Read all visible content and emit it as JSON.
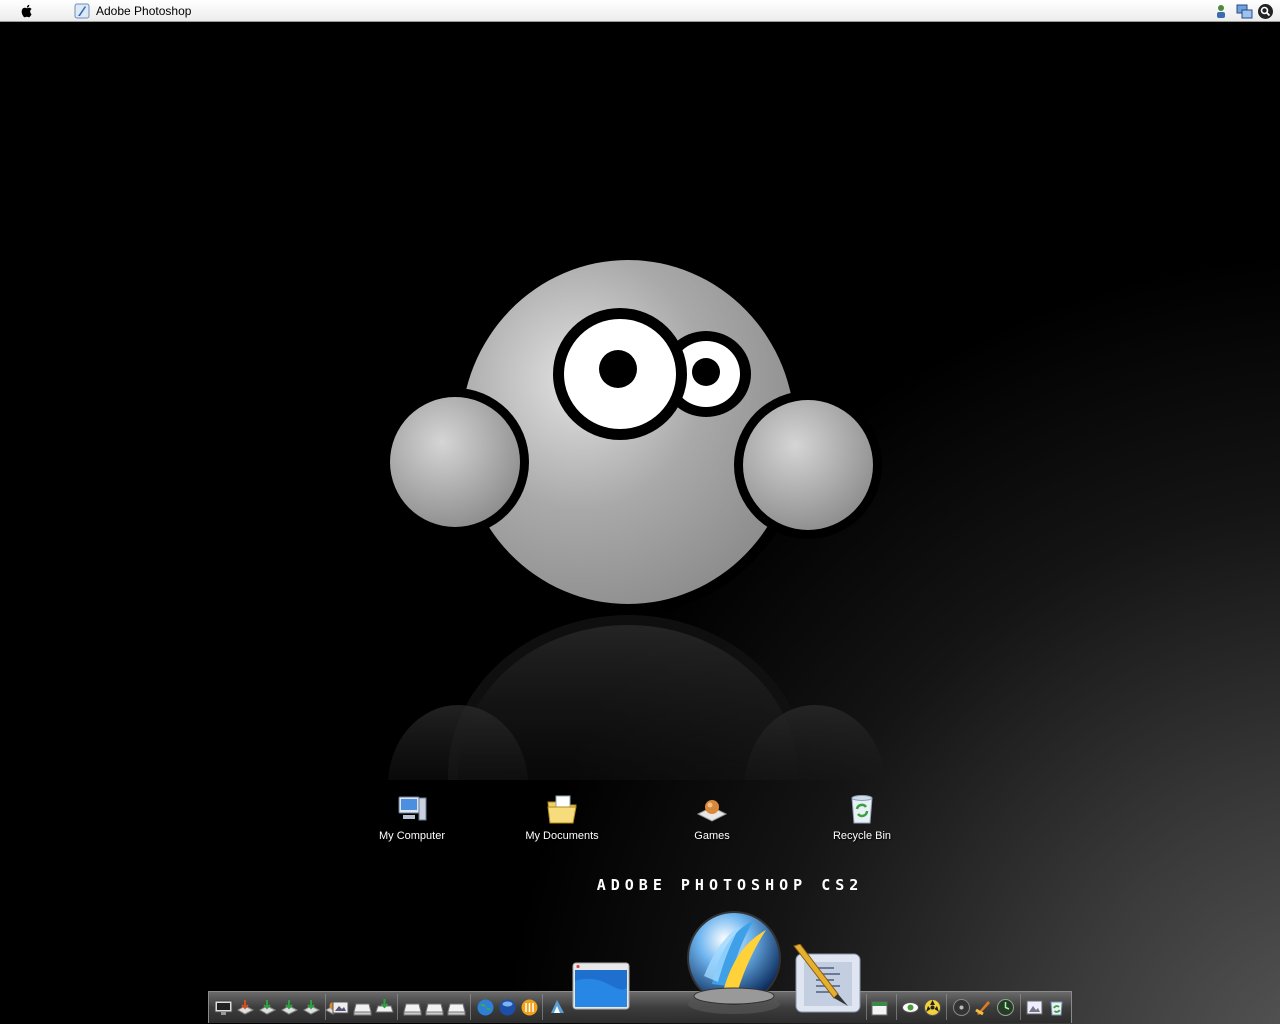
{
  "menubar": {
    "app_title": "Adobe Photoshop"
  },
  "desktop": {
    "icons": [
      {
        "label": "My Computer"
      },
      {
        "label": "My Documents"
      },
      {
        "label": "Games"
      },
      {
        "label": "Recycle Bin"
      }
    ],
    "banner": "Adobe Photoshop CS2"
  },
  "colors": {
    "menubar_bg": "#f2f2f2",
    "wallpaper_dark": "#000000",
    "wallpaper_light": "#5c5c5c",
    "mascot_gray": "#a9a9a9"
  },
  "icons": {
    "tray": [
      "user-icon",
      "network-icon",
      "search-icon"
    ],
    "dock": [
      "display-icon",
      "download-icon",
      "folder-icon",
      "drive-icon",
      "globe-icon",
      "finder-window-icon",
      "photoshop-icon",
      "illustrator-icon",
      "trash-icon"
    ]
  }
}
